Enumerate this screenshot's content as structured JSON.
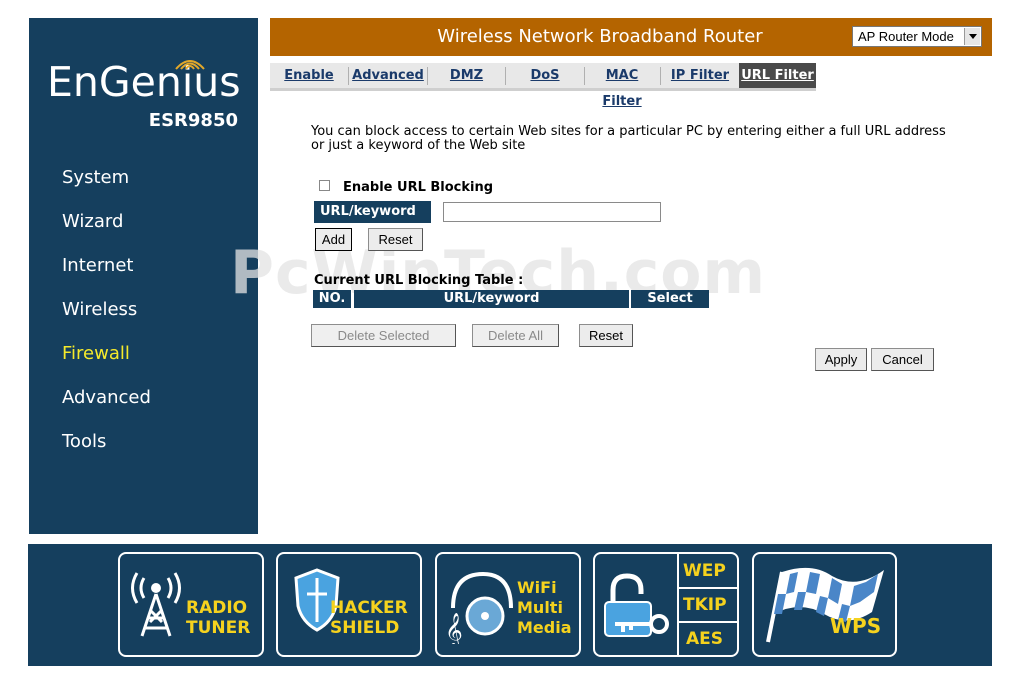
{
  "brand": {
    "logo": "EnGenius",
    "model": "ESR9850"
  },
  "nav": [
    {
      "label": "System"
    },
    {
      "label": "Wizard"
    },
    {
      "label": "Internet"
    },
    {
      "label": "Wireless"
    },
    {
      "label": "Firewall",
      "active": true
    },
    {
      "label": "Advanced"
    },
    {
      "label": "Tools"
    }
  ],
  "header": {
    "title": "Wireless Network Broadband Router",
    "mode_selected": "AP Router Mode"
  },
  "tabs": [
    {
      "label": "Enable"
    },
    {
      "label": "Advanced"
    },
    {
      "label": "DMZ"
    },
    {
      "label": "DoS"
    },
    {
      "label": "MAC Filter"
    },
    {
      "label": "IP Filter"
    },
    {
      "label": "URL Filter",
      "active": true
    }
  ],
  "content": {
    "intro": "You can block access to certain Web sites for a particular PC by entering either a full URL address or just a keyword of the Web site",
    "enable_label": "Enable URL Blocking",
    "enable_checked": false,
    "url_label": "URL/keyword",
    "url_value": "",
    "add_label": "Add",
    "reset_label": "Reset",
    "table_caption": "Current URL Blocking Table :",
    "table_headers": [
      "NO.",
      "URL/keyword",
      "Select"
    ],
    "delete_selected_label": "Delete Selected",
    "delete_all_label": "Delete All",
    "reset2_label": "Reset",
    "apply_label": "Apply",
    "cancel_label": "Cancel"
  },
  "watermark": "PcWinTech.com",
  "footer": {
    "radio_tuner": [
      "RADIO",
      "TUNER"
    ],
    "hacker_shield": [
      "HACKER",
      "SHIELD"
    ],
    "wifi_media": [
      "WiFi",
      "Multi",
      "Media"
    ],
    "security": [
      "WEP",
      "TKIP",
      "AES"
    ],
    "wps": "WPS"
  },
  "colors": {
    "navy": "#153f5e",
    "orange": "#b46400",
    "active_nav": "#f5ea2b",
    "footer_text": "#f5d21e"
  }
}
